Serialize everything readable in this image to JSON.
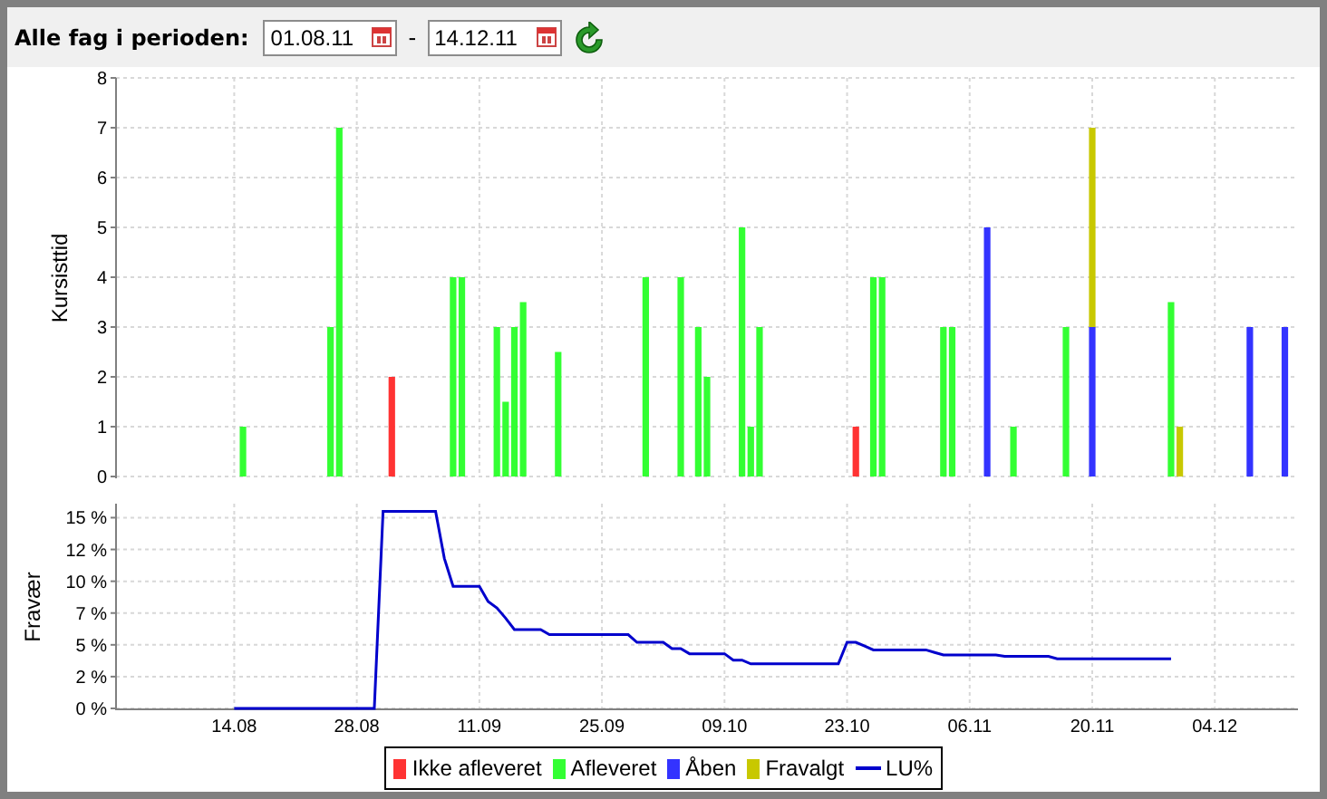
{
  "toolbar": {
    "label": "Alle fag i perioden:",
    "from": {
      "value": "01.08.11"
    },
    "separator": "-",
    "to": {
      "value": "14.12.11"
    }
  },
  "hours_chart": {
    "chart_data": {
      "type": "bar",
      "stacked": true,
      "grid": true,
      "ylabel": "Kursisttid",
      "ylim": [
        0,
        8
      ],
      "yticks": [
        {
          "value": 0,
          "label": "0"
        },
        {
          "value": 1,
          "label": "1"
        },
        {
          "value": 2,
          "label": "2"
        },
        {
          "value": 3,
          "label": "3"
        },
        {
          "value": 4,
          "label": "4"
        },
        {
          "value": 5,
          "label": "5"
        },
        {
          "value": 6,
          "label": "6"
        },
        {
          "value": 7,
          "label": "7"
        },
        {
          "value": 8,
          "label": "8"
        }
      ],
      "categories": [
        null,
        null,
        null,
        null,
        null,
        null,
        null,
        null,
        null,
        null,
        null,
        null,
        null,
        null,
        null,
        null,
        null,
        null,
        null,
        null,
        null,
        null,
        null,
        null,
        null,
        null,
        null,
        null,
        null,
        null,
        null,
        null,
        null,
        null,
        null,
        null,
        null,
        null,
        null,
        null,
        null,
        null,
        null,
        null,
        null,
        null,
        null,
        null,
        null,
        null,
        null,
        null,
        null,
        null,
        null,
        null,
        null,
        null,
        null,
        null,
        null,
        null,
        null,
        null,
        null,
        null,
        null,
        null,
        null,
        null,
        null,
        null,
        null,
        null,
        null,
        null,
        null,
        null,
        null,
        null,
        null,
        null,
        null,
        null,
        null,
        null,
        null,
        null,
        null,
        null,
        null,
        null,
        null,
        null,
        null,
        null,
        null,
        null,
        null,
        null,
        null,
        null,
        null,
        null,
        null,
        null,
        null,
        null,
        null,
        null,
        null,
        null,
        null,
        null,
        null,
        null,
        null,
        null,
        null,
        null,
        null,
        null,
        null,
        null,
        null,
        null,
        null,
        null,
        null,
        null,
        null,
        null,
        null,
        null,
        null
      ],
      "series": [
        {
          "name": "Ikke afleveret",
          "color": "#ff3333",
          "values": [
            null,
            null,
            null,
            null,
            null,
            null,
            null,
            null,
            null,
            null,
            null,
            null,
            null,
            null,
            null,
            null,
            null,
            null,
            null,
            null,
            null,
            null,
            null,
            null,
            null,
            null,
            null,
            null,
            null,
            null,
            null,
            2,
            null,
            null,
            null,
            null,
            null,
            null,
            null,
            null,
            null,
            null,
            null,
            null,
            null,
            null,
            null,
            null,
            null,
            null,
            null,
            null,
            null,
            null,
            null,
            null,
            null,
            null,
            null,
            null,
            null,
            null,
            null,
            null,
            null,
            null,
            null,
            null,
            null,
            null,
            null,
            null,
            null,
            null,
            null,
            null,
            null,
            null,
            null,
            null,
            null,
            null,
            null,
            null,
            1,
            null,
            null,
            null,
            null,
            null,
            null,
            null,
            null,
            null,
            null,
            null,
            null,
            null,
            null,
            null,
            null,
            null,
            null,
            null,
            null,
            null,
            null,
            null,
            null,
            null,
            null,
            null,
            null,
            null,
            null,
            null,
            null,
            null,
            null,
            null,
            null,
            null,
            null,
            null,
            null,
            null,
            null,
            null,
            null,
            null,
            null,
            null,
            null,
            null,
            null
          ]
        },
        {
          "name": "Afleveret",
          "color": "#33ff33",
          "values": [
            null,
            null,
            null,
            null,
            null,
            null,
            null,
            null,
            null,
            null,
            null,
            null,
            null,
            null,
            1,
            null,
            null,
            null,
            null,
            null,
            null,
            null,
            null,
            null,
            3,
            7,
            null,
            null,
            null,
            null,
            null,
            null,
            null,
            null,
            null,
            null,
            null,
            null,
            4,
            4,
            null,
            null,
            null,
            3,
            1.5,
            3,
            3.5,
            null,
            null,
            null,
            2.5,
            null,
            null,
            null,
            null,
            null,
            null,
            null,
            null,
            null,
            4,
            null,
            null,
            null,
            4,
            null,
            3,
            2,
            null,
            null,
            null,
            5,
            1,
            3,
            null,
            null,
            null,
            null,
            null,
            null,
            null,
            null,
            null,
            null,
            null,
            null,
            4,
            4,
            null,
            null,
            null,
            null,
            null,
            null,
            3,
            3,
            null,
            null,
            null,
            null,
            null,
            null,
            1,
            null,
            null,
            null,
            null,
            null,
            3,
            null,
            null,
            null,
            null,
            null,
            null,
            null,
            null,
            null,
            null,
            null,
            3.5,
            null,
            null,
            null,
            null,
            null,
            null,
            null,
            null,
            null,
            null,
            null,
            null,
            null,
            null
          ]
        },
        {
          "name": "Åben",
          "color": "#3333ff",
          "values": [
            null,
            null,
            null,
            null,
            null,
            null,
            null,
            null,
            null,
            null,
            null,
            null,
            null,
            null,
            null,
            null,
            null,
            null,
            null,
            null,
            null,
            null,
            null,
            null,
            null,
            null,
            null,
            null,
            null,
            null,
            null,
            null,
            null,
            null,
            null,
            null,
            null,
            null,
            null,
            null,
            null,
            null,
            null,
            null,
            null,
            null,
            null,
            null,
            null,
            null,
            null,
            null,
            null,
            null,
            null,
            null,
            null,
            null,
            null,
            null,
            null,
            null,
            null,
            null,
            null,
            null,
            null,
            null,
            null,
            null,
            null,
            null,
            null,
            null,
            null,
            null,
            null,
            null,
            null,
            null,
            null,
            null,
            null,
            null,
            null,
            null,
            null,
            null,
            null,
            null,
            null,
            null,
            null,
            null,
            null,
            null,
            null,
            null,
            null,
            5,
            null,
            null,
            null,
            null,
            null,
            null,
            null,
            null,
            null,
            null,
            null,
            3,
            null,
            null,
            null,
            null,
            null,
            null,
            null,
            null,
            null,
            null,
            null,
            null,
            null,
            null,
            null,
            null,
            null,
            3,
            null,
            null,
            null,
            3,
            null
          ]
        },
        {
          "name": "Fravalgt",
          "color": "#c8c800",
          "values": [
            null,
            null,
            null,
            null,
            null,
            null,
            null,
            null,
            null,
            null,
            null,
            null,
            null,
            null,
            null,
            null,
            null,
            null,
            null,
            null,
            null,
            null,
            null,
            null,
            null,
            null,
            null,
            null,
            null,
            null,
            null,
            null,
            null,
            null,
            null,
            null,
            null,
            null,
            null,
            null,
            null,
            null,
            null,
            null,
            null,
            null,
            null,
            null,
            null,
            null,
            null,
            null,
            null,
            null,
            null,
            null,
            null,
            null,
            null,
            null,
            null,
            null,
            null,
            null,
            null,
            null,
            null,
            null,
            null,
            null,
            null,
            null,
            null,
            null,
            null,
            null,
            null,
            null,
            null,
            null,
            null,
            null,
            null,
            null,
            null,
            null,
            null,
            null,
            null,
            null,
            null,
            null,
            null,
            null,
            null,
            null,
            null,
            null,
            null,
            null,
            null,
            null,
            null,
            null,
            null,
            null,
            null,
            null,
            null,
            null,
            null,
            4,
            null,
            null,
            null,
            null,
            null,
            null,
            null,
            null,
            null,
            1,
            null,
            null,
            null,
            null,
            null,
            null,
            null,
            null,
            null,
            null,
            null,
            null,
            null
          ]
        }
      ]
    }
  },
  "absence_chart": {
    "chart_data": {
      "type": "line",
      "grid": true,
      "ylabel": "Fravær",
      "ylim": [
        0,
        16.1
      ],
      "yticks": [
        {
          "value": 0,
          "label": "0 %"
        },
        {
          "value": 2.5,
          "label": "2 %"
        },
        {
          "value": 5,
          "label": "5 %"
        },
        {
          "value": 7.5,
          "label": "7 %"
        },
        {
          "value": 10,
          "label": "10 %"
        },
        {
          "value": 12.5,
          "label": "12 %"
        },
        {
          "value": 15,
          "label": "15 %"
        }
      ],
      "categories": [
        null,
        null,
        null,
        null,
        null,
        null,
        null,
        null,
        null,
        null,
        null,
        null,
        null,
        "14.08",
        null,
        null,
        null,
        null,
        null,
        null,
        null,
        null,
        null,
        null,
        null,
        null,
        null,
        "28.08",
        null,
        null,
        null,
        null,
        null,
        null,
        null,
        null,
        null,
        null,
        null,
        null,
        null,
        "11.09",
        null,
        null,
        null,
        null,
        null,
        null,
        null,
        null,
        null,
        null,
        null,
        null,
        null,
        "25.09",
        null,
        null,
        null,
        null,
        null,
        null,
        null,
        null,
        null,
        null,
        null,
        null,
        null,
        "09.10",
        null,
        null,
        null,
        null,
        null,
        null,
        null,
        null,
        null,
        null,
        null,
        null,
        null,
        "23.10",
        null,
        null,
        null,
        null,
        null,
        null,
        null,
        null,
        null,
        null,
        null,
        null,
        null,
        "06.11",
        null,
        null,
        null,
        null,
        null,
        null,
        null,
        null,
        null,
        null,
        null,
        null,
        null,
        "20.11",
        null,
        null,
        null,
        null,
        null,
        null,
        null,
        null,
        null,
        null,
        null,
        null,
        null,
        "04.12",
        null,
        null,
        null,
        null,
        null,
        null,
        null,
        null,
        null
      ],
      "series": [
        {
          "name": "LU%",
          "color": "#0000cc",
          "values": [
            null,
            null,
            null,
            null,
            null,
            null,
            null,
            null,
            null,
            null,
            null,
            null,
            null,
            0,
            0,
            0,
            0,
            0,
            0,
            0,
            0,
            0,
            0,
            0,
            0,
            0,
            0,
            0,
            0,
            0,
            15.5,
            15.5,
            15.5,
            15.5,
            15.5,
            15.5,
            15.5,
            11.8,
            9.6,
            9.6,
            9.6,
            9.6,
            8.4,
            7.9,
            7.1,
            6.2,
            6.2,
            6.2,
            6.2,
            5.8,
            5.8,
            5.8,
            5.8,
            5.8,
            5.8,
            5.8,
            5.8,
            5.8,
            5.8,
            5.2,
            5.2,
            5.2,
            5.2,
            4.7,
            4.7,
            4.3,
            4.3,
            4.3,
            4.3,
            4.3,
            3.8,
            3.8,
            3.5,
            3.5,
            3.5,
            3.5,
            3.5,
            3.5,
            3.5,
            3.5,
            3.5,
            3.5,
            3.5,
            5.2,
            5.2,
            4.9,
            4.6,
            4.6,
            4.6,
            4.6,
            4.6,
            4.6,
            4.6,
            4.4,
            4.2,
            4.2,
            4.2,
            4.2,
            4.2,
            4.2,
            4.2,
            4.1,
            4.1,
            4.1,
            4.1,
            4.1,
            4.1,
            3.9,
            3.9,
            3.9,
            3.9,
            3.9,
            3.9,
            3.9,
            3.9,
            3.9,
            3.9,
            3.9,
            3.9,
            3.9,
            3.9,
            null,
            null,
            null,
            null,
            null,
            null,
            null,
            null,
            null,
            null,
            null,
            null,
            null,
            null
          ]
        }
      ]
    }
  }
}
